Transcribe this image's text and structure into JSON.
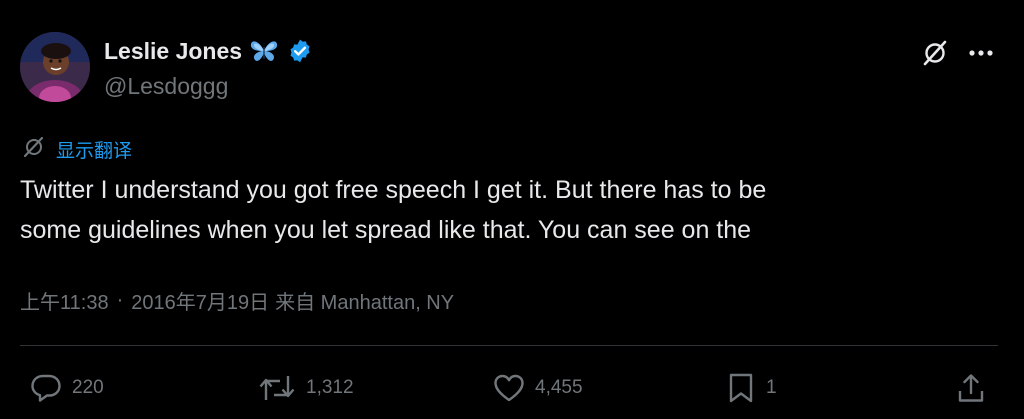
{
  "author": {
    "name": "Leslie Jones",
    "handle": "@Lesdoggg",
    "butterfly_emoji_icon": "butterfly-icon",
    "verified_icon": "verified-badge-icon",
    "verified_color": "#1d9bf0"
  },
  "header": {
    "grok_icon": "grok-icon",
    "more_icon": "more-icon"
  },
  "translate": {
    "icon": "grok-icon",
    "label": "显示翻译",
    "color": "#1d9bf0"
  },
  "tweet": {
    "line1": "Twitter I understand you got free speech I get it. But there has to be",
    "line2": "some guidelines when you let spread like that. You can see on the"
  },
  "meta": {
    "time": "上午11:38",
    "separator": "·",
    "date": "2016年7月19日",
    "location": "来自 Manhattan, NY"
  },
  "actions": {
    "reply": {
      "icon": "reply-icon",
      "count": "220"
    },
    "retweet": {
      "icon": "retweet-icon",
      "count": "1,312"
    },
    "like": {
      "icon": "heart-icon",
      "count": "4,455"
    },
    "bookmark": {
      "icon": "bookmark-icon",
      "count": "1"
    },
    "share": {
      "icon": "share-icon"
    }
  },
  "colors": {
    "background": "#000000",
    "text": "#e7e9ea",
    "secondary": "#71767b",
    "accent": "#1d9bf0",
    "divider": "#2f3336"
  }
}
